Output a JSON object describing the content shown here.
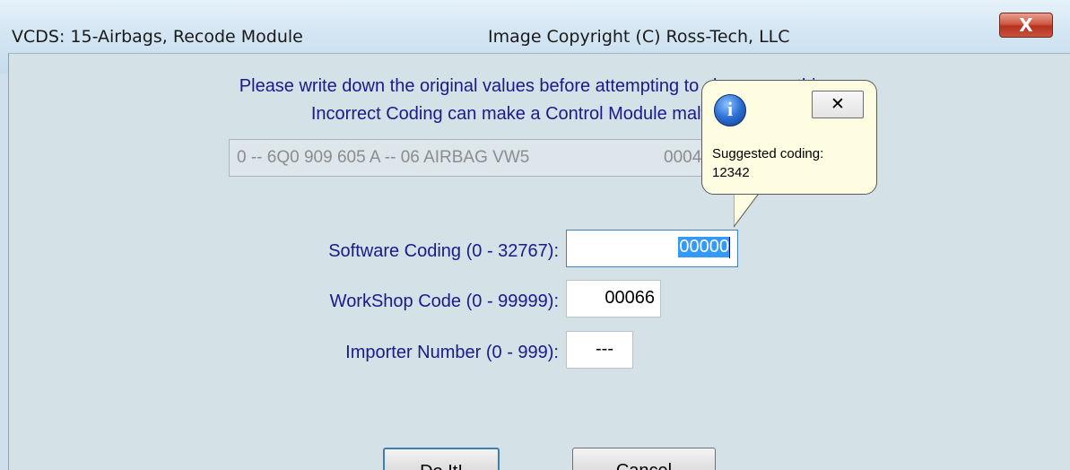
{
  "window": {
    "title": "VCDS: 15-Airbags,  Recode Module",
    "copyright": "Image Copyright (C) Ross-Tech, LLC",
    "close_label": "X"
  },
  "warning": {
    "line1": "Please write down the original values before attempting to change anything.",
    "line2": "Incorrect Coding can make a Control Module malfunction!"
  },
  "module": {
    "description": "0 -- 6Q0 909 605 A -- 06 AIRBAG VW5",
    "number": "0004"
  },
  "fields": {
    "software_coding_label": "Software Coding (0 - 32767):",
    "software_coding_value": "00000",
    "workshop_code_label": "WorkShop Code (0 - 99999):",
    "workshop_code_value": "00066",
    "importer_number_label": "Importer Number (0 - 999):",
    "importer_number_value": "---"
  },
  "buttons": {
    "do_it_label": "Do It!",
    "cancel_label": "Cancel"
  },
  "tooltip": {
    "icon": "info-icon",
    "close_label": "✕",
    "line1": "Suggested coding:",
    "line2": "12342"
  }
}
